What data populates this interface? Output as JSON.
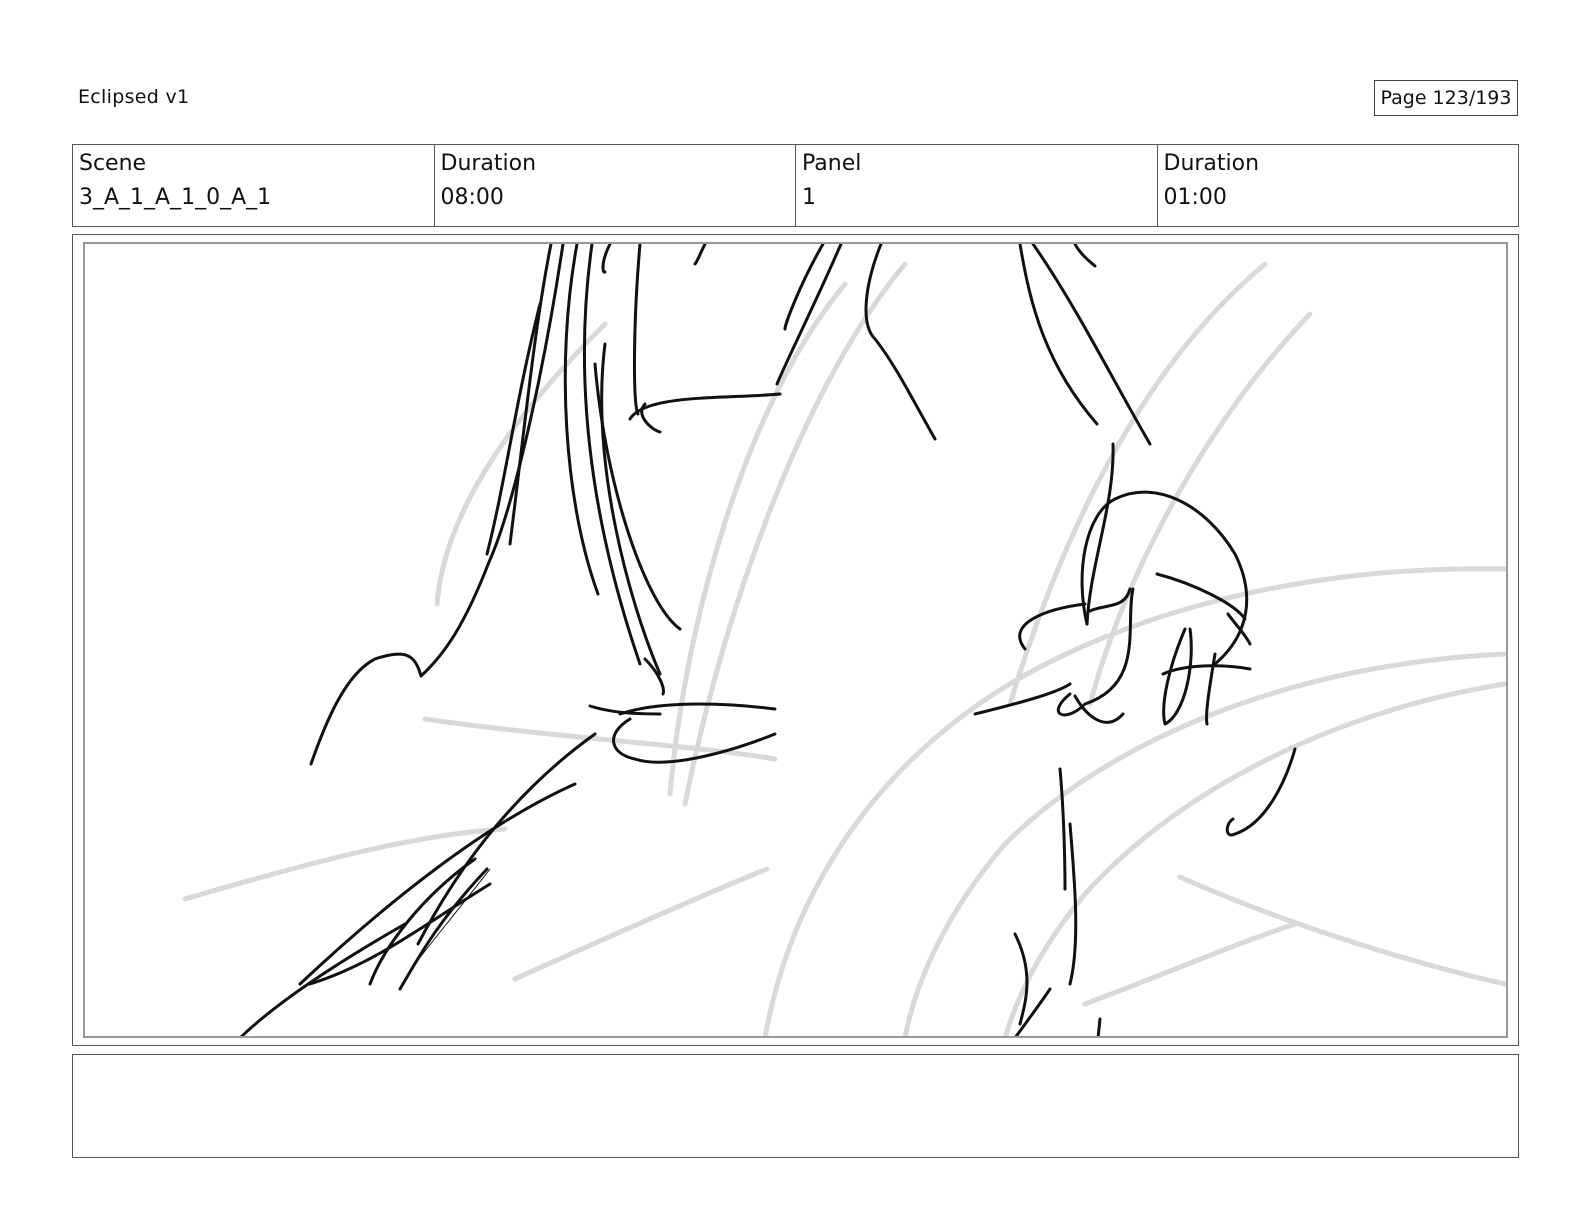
{
  "header": {
    "project_title": "Eclipsed v1",
    "page_label": "Page 123/193"
  },
  "info": {
    "scene_label": "Scene",
    "scene_value": "3_A_1_A_1_0_A_1",
    "scene_duration_label": "Duration",
    "scene_duration_value": "08:00",
    "panel_label": "Panel",
    "panel_value": "1",
    "panel_duration_label": "Duration",
    "panel_duration_value": "01:00"
  },
  "notes": {
    "text": ""
  },
  "colors": {
    "ink": "#111111",
    "sketch_guides": "#d9d9d9",
    "frame_border": "#555555"
  }
}
